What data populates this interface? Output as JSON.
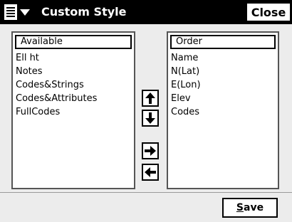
{
  "header": {
    "title": "Custom Style",
    "close_label": "Close",
    "menu_icon": "menu-list-icon"
  },
  "available": {
    "header": "Available",
    "items": [
      "Ell ht",
      "Notes",
      "Codes&Strings",
      "Codes&Attributes",
      "FullCodes"
    ]
  },
  "order": {
    "header": "Order",
    "items": [
      "Name",
      "N(Lat)",
      "E(Lon)",
      "Elev",
      "Codes"
    ]
  },
  "buttons": {
    "save_mnemonic": "S",
    "save_rest": "ave"
  }
}
